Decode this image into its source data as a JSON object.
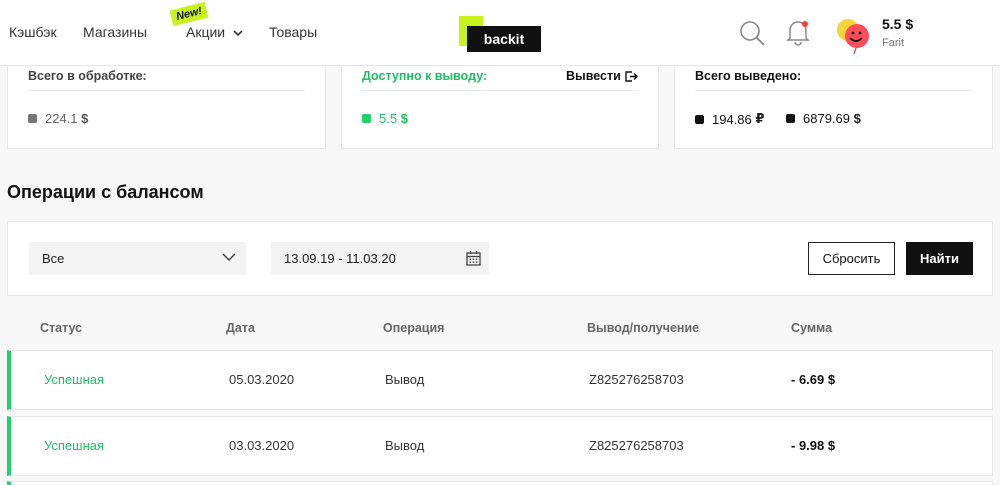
{
  "nav": {
    "items": [
      {
        "label": "Кэшбэк"
      },
      {
        "label": "Магазины"
      },
      {
        "label": "Акции"
      },
      {
        "label": "Товары"
      }
    ],
    "new_badge": "New!"
  },
  "logo": {
    "text": "backit"
  },
  "user": {
    "balance": "5.5 $",
    "name": "Farit"
  },
  "cards": {
    "processing": {
      "label": "Всего в обработке:",
      "value": "224.1",
      "currency": "$",
      "color": "#777777"
    },
    "available": {
      "label": "Доступно к выводу:",
      "value": "5.5",
      "currency": "$",
      "action": "Вывести",
      "color": "#1fd36b"
    },
    "withdrawn": {
      "label": "Всего выведено:",
      "values": [
        {
          "value": "194.86",
          "currency": "₽"
        },
        {
          "value": "6879.69",
          "currency": "$"
        }
      ]
    }
  },
  "section_title": "Операции с балансом",
  "filters": {
    "type_selected": "Все",
    "date_range": "13.09.19 - 11.03.20",
    "reset_label": "Сбросить",
    "find_label": "Найти"
  },
  "table": {
    "columns": [
      "Статус",
      "Дата",
      "Операция",
      "Вывод/получение",
      "Сумма"
    ],
    "rows": [
      {
        "status": "Успешная",
        "date": "05.03.2020",
        "operation": "Вывод",
        "account": "Z825276258703",
        "sum": "- 6.69 $"
      },
      {
        "status": "Успешная",
        "date": "03.03.2020",
        "operation": "Вывод",
        "account": "Z825276258703",
        "sum": "- 9.98 $"
      }
    ]
  },
  "colors": {
    "accent": "#c8f21e",
    "success": "#1fd36b",
    "dark": "#111111"
  },
  "icons": [
    "search-icon",
    "bell-icon",
    "chevron-down-icon",
    "calendar-icon",
    "exit-icon"
  ]
}
